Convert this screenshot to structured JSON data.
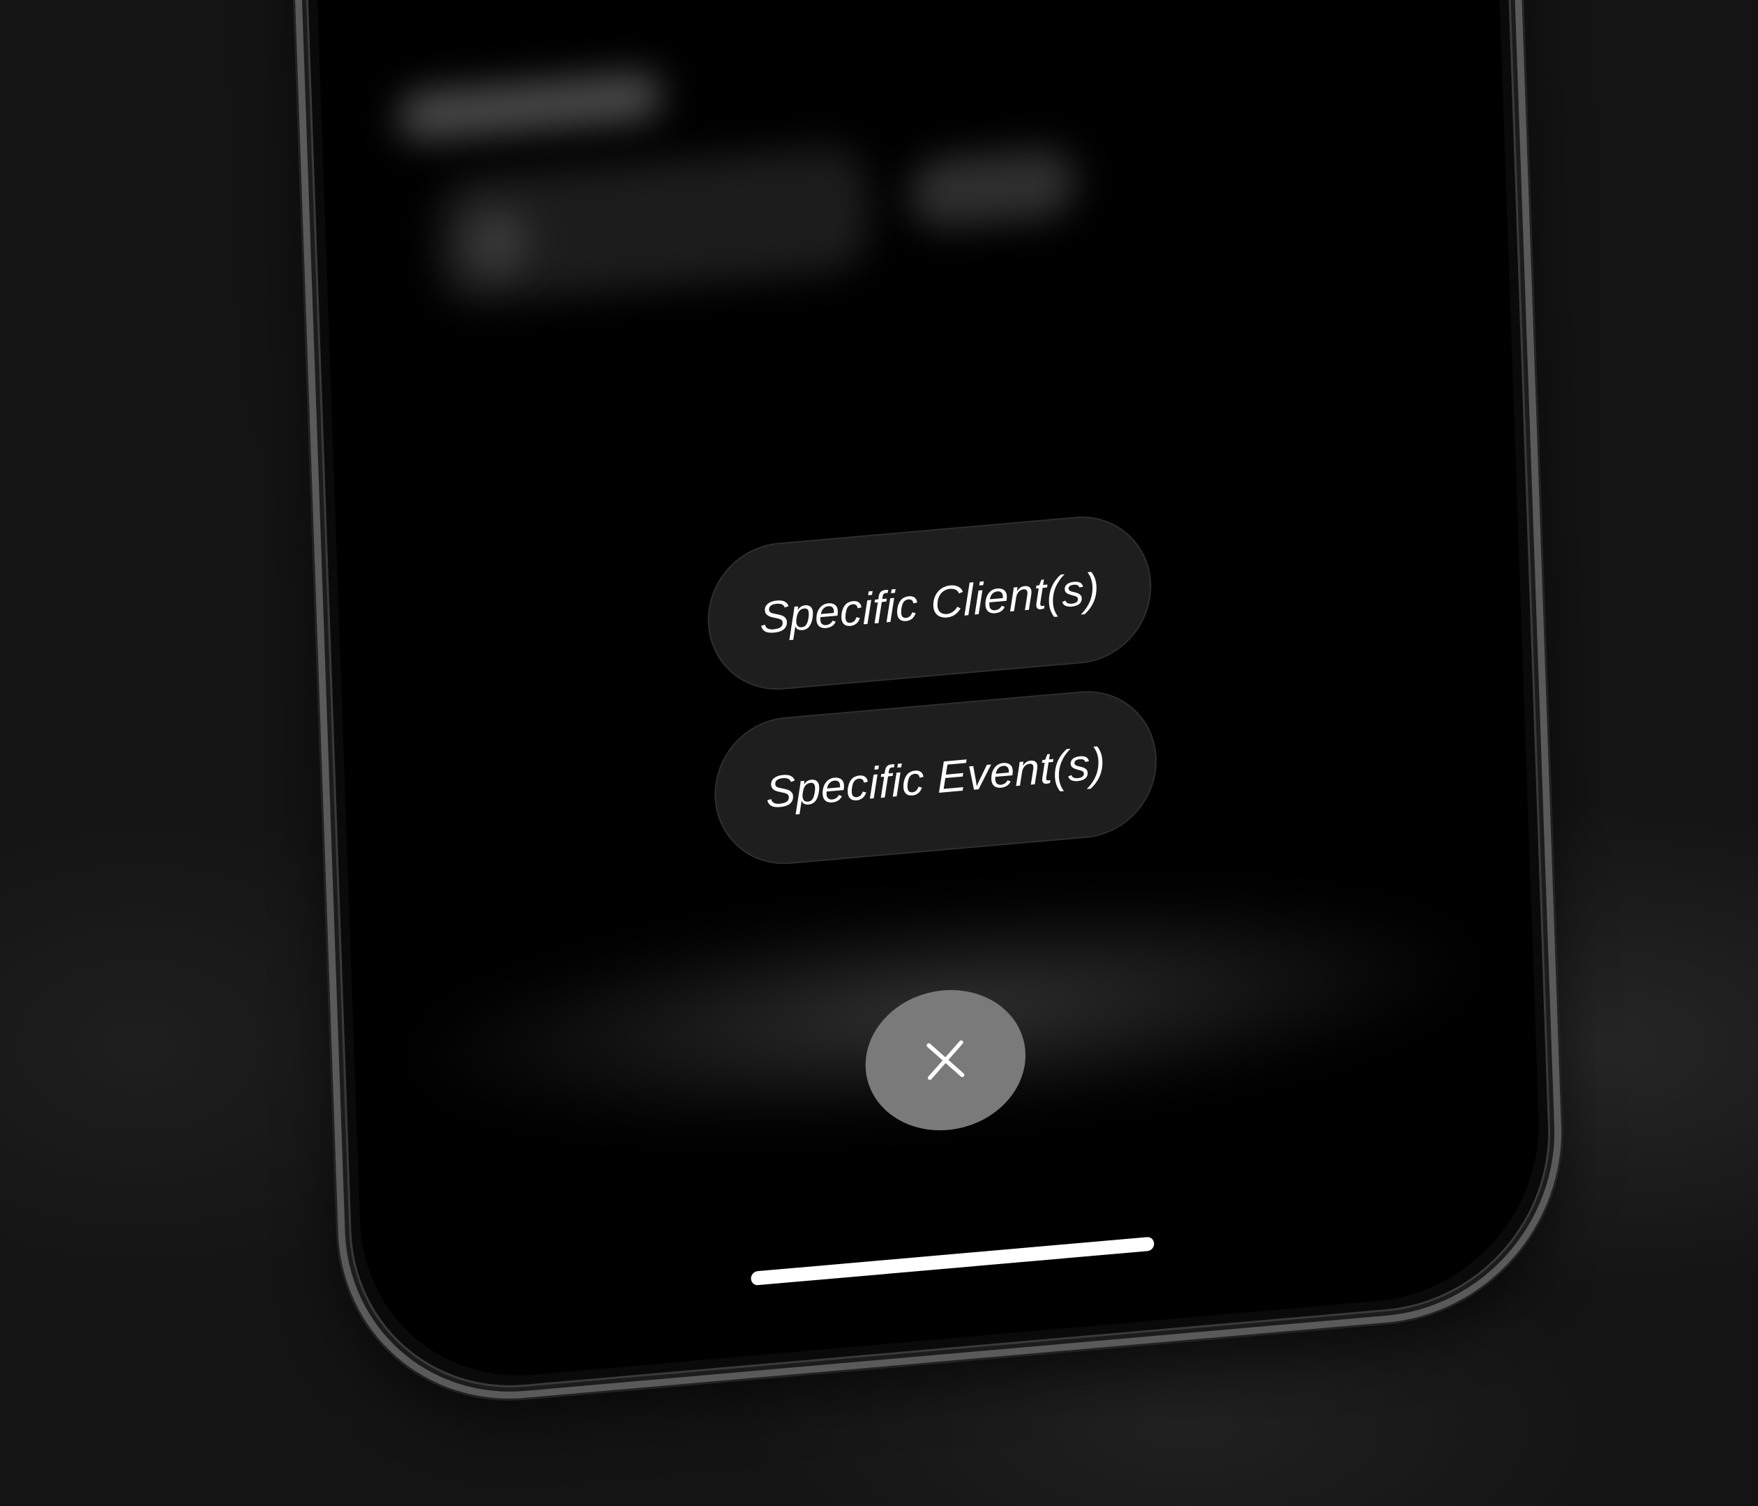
{
  "options": [
    {
      "label": "Specific Client(s)"
    },
    {
      "label": "Specific Event(s)"
    }
  ],
  "close_button": {
    "icon": "close-icon"
  },
  "colors": {
    "background": "#141414",
    "screen": "#000000",
    "pill": "#1e1e1e",
    "close_button": "#7a7a7a",
    "text": "#ffffff"
  }
}
